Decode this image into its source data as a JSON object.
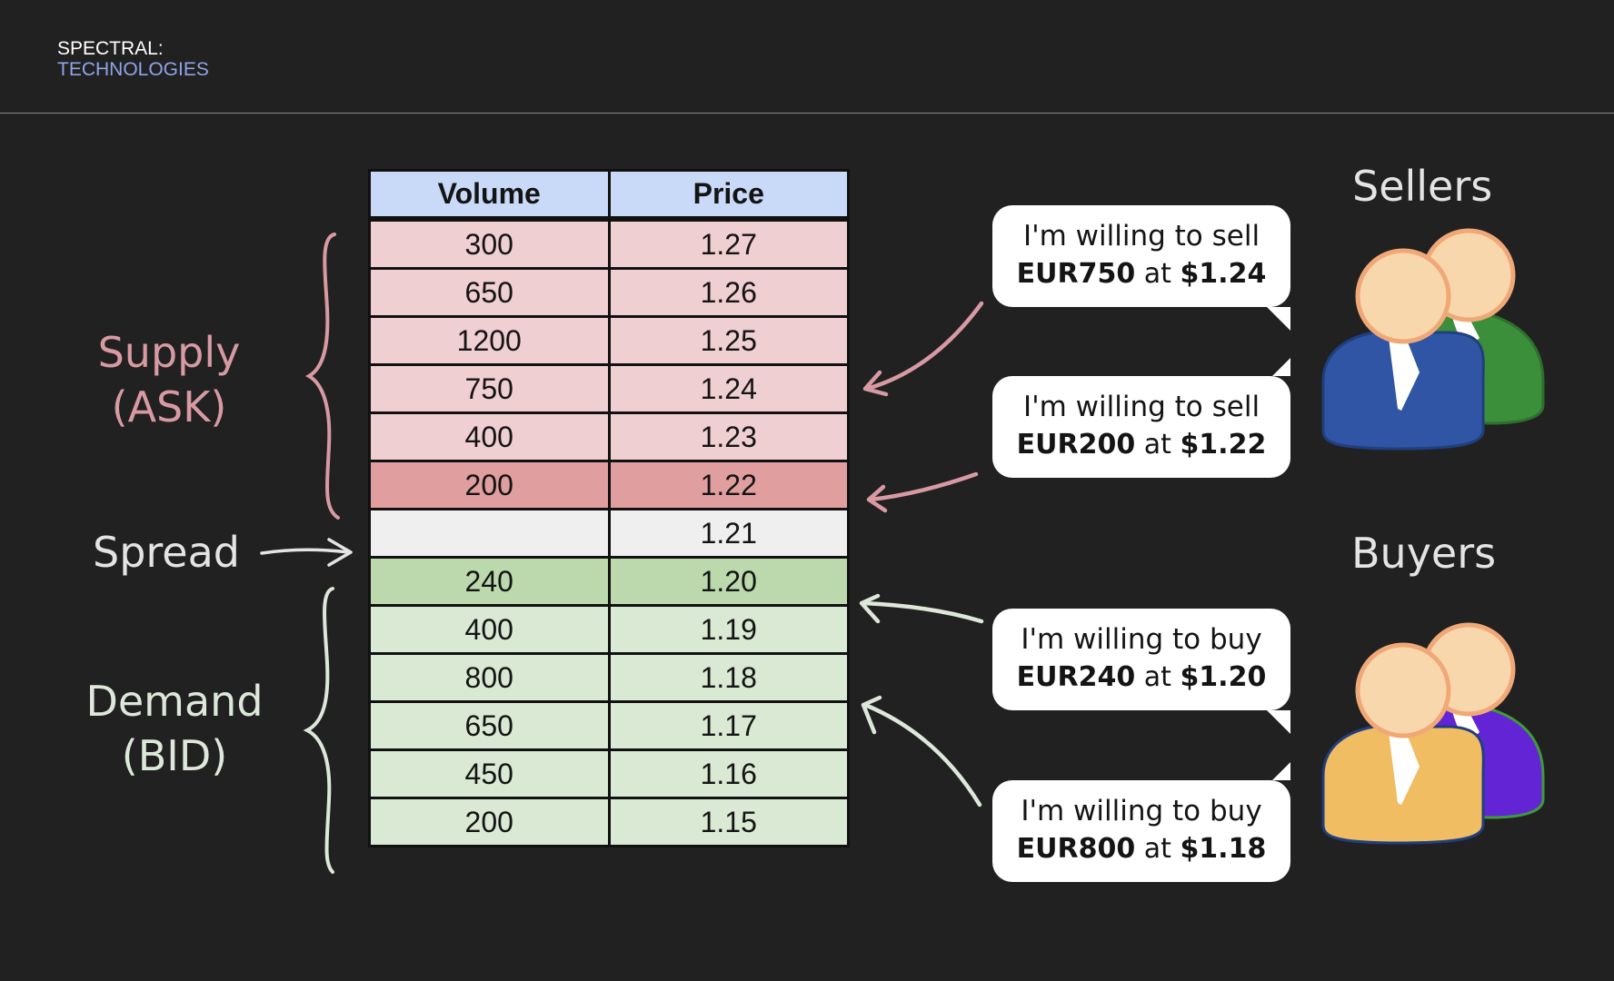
{
  "brand": {
    "line1": "SPECTRAL:",
    "line2": "TECHNOLOGIES"
  },
  "table": {
    "headers": [
      "Volume",
      "Price"
    ],
    "ask": [
      {
        "volume": "300",
        "price": "1.27"
      },
      {
        "volume": "650",
        "price": "1.26"
      },
      {
        "volume": "1200",
        "price": "1.25"
      },
      {
        "volume": "750",
        "price": "1.24"
      },
      {
        "volume": "400",
        "price": "1.23"
      },
      {
        "volume": "200",
        "price": "1.22"
      }
    ],
    "spread": {
      "volume": "",
      "price": "1.21"
    },
    "bid": [
      {
        "volume": "240",
        "price": "1.20"
      },
      {
        "volume": "400",
        "price": "1.19"
      },
      {
        "volume": "800",
        "price": "1.18"
      },
      {
        "volume": "650",
        "price": "1.17"
      },
      {
        "volume": "450",
        "price": "1.16"
      },
      {
        "volume": "200",
        "price": "1.15"
      }
    ]
  },
  "labels": {
    "supply_line1": "Supply",
    "supply_line2": "(ASK)",
    "spread": "Spread",
    "demand_line1": "Demand",
    "demand_line2": "(BID)",
    "sellers": "Sellers",
    "buyers": "Buyers"
  },
  "bubbles": [
    {
      "text": "I'm willing to sell",
      "amount": "EUR750",
      "mid": " at ",
      "price": "$1.24"
    },
    {
      "text": "I'm willing to sell",
      "amount": "EUR200",
      "mid": " at ",
      "price": "$1.22"
    },
    {
      "text": "I'm willing to buy",
      "amount": "EUR240",
      "mid": " at ",
      "price": "$1.20"
    },
    {
      "text": "I'm willing to buy",
      "amount": "EUR800",
      "mid": " at ",
      "price": "$1.18"
    }
  ],
  "colors": {
    "ask_row": "#efcfd1",
    "ask_best": "#e09e9f",
    "spread_row": "#efefef",
    "bid_best": "#bcd9ae",
    "bid_row": "#dae9d4",
    "header": "#c9d9f8",
    "supply_accent": "#d89aa2",
    "demand_accent": "#dde8da",
    "brand_accent": "#8fa5e6"
  },
  "icons": [
    "sellers-group-icon",
    "buyers-group-icon"
  ]
}
